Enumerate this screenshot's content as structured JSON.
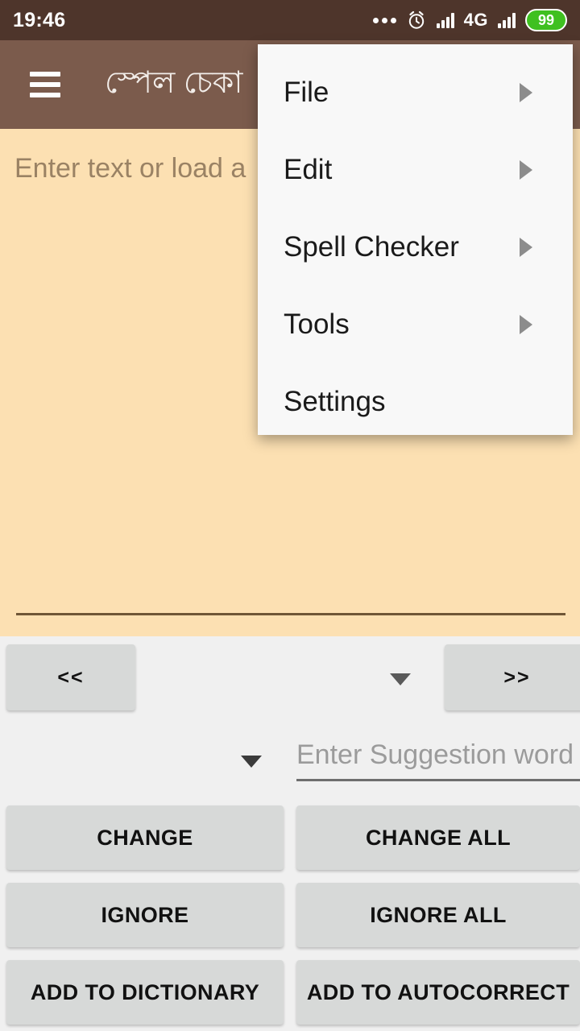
{
  "statusbar": {
    "time": "19:46",
    "icons": [
      "more-dots-icon",
      "alarm-clock-icon",
      "signal-bars-icon",
      "network-4g-label",
      "signal-bars-icon-2",
      "battery-icon"
    ],
    "network": "4G",
    "battery_level": "99"
  },
  "appbar": {
    "menu_icon": "hamburger-menu-icon",
    "title": "স্পেল চেকা",
    "background": "#7B5B4C"
  },
  "editor": {
    "placeholder": "Enter text or load a",
    "value": "",
    "background": "#FCE0B2"
  },
  "navigation": {
    "prev_label": "<<",
    "next_label": ">>",
    "dropdown_icon": "chevron-down-icon"
  },
  "suggestion": {
    "dropdown_icon": "chevron-down-icon",
    "placeholder": "Enter Suggestion word",
    "value": ""
  },
  "actions": [
    {
      "left": "CHANGE",
      "right": "CHANGE ALL"
    },
    {
      "left": "IGNORE",
      "right": "IGNORE ALL"
    },
    {
      "left": "ADD TO DICTIONARY",
      "right": "ADD TO AUTOCORRECT"
    }
  ],
  "menu": {
    "visible": true,
    "items": [
      {
        "label": "File",
        "has_submenu": true
      },
      {
        "label": "Edit",
        "has_submenu": true
      },
      {
        "label": "Spell Checker",
        "has_submenu": true
      },
      {
        "label": "Tools",
        "has_submenu": true
      },
      {
        "label": "Settings",
        "has_submenu": false
      }
    ]
  },
  "colors": {
    "statusbar": "#4E352B",
    "appbar": "#7B5B4C",
    "editor_bg": "#FCE0B2",
    "panel_bg": "#F0F0F0",
    "button_bg": "#D7D9D8",
    "battery_green": "#3FC020"
  }
}
